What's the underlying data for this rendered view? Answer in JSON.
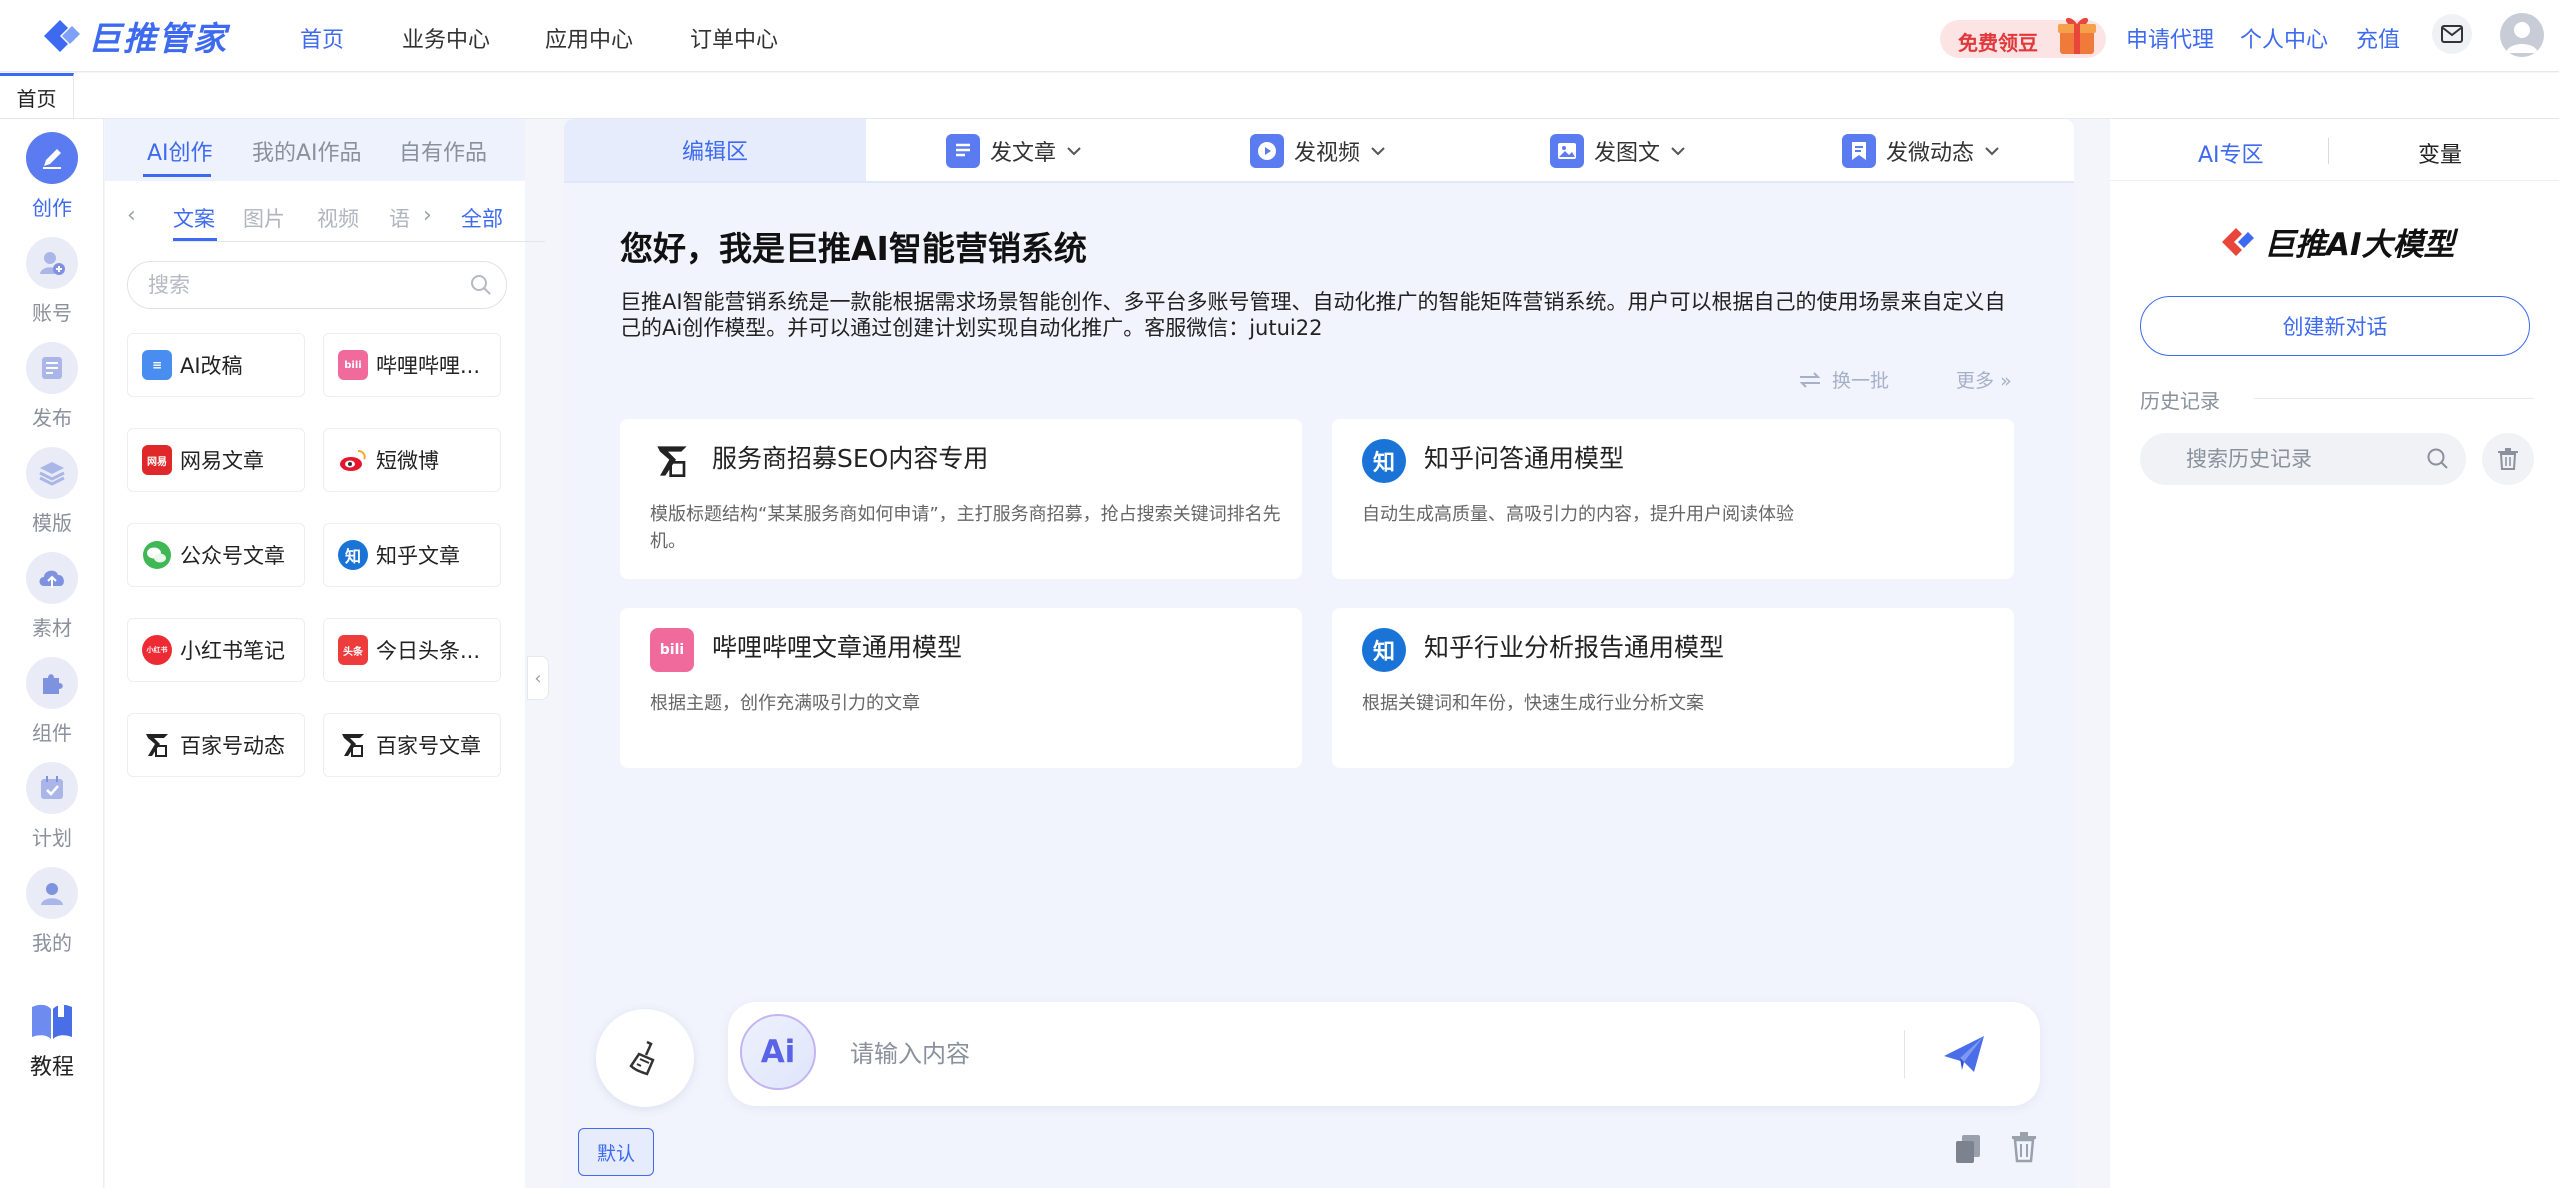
{
  "brand": {
    "name": "巨推管家",
    "accent": "#3d6af0"
  },
  "topnav": {
    "items": [
      "首页",
      "业务中心",
      "应用中心",
      "订单中心"
    ],
    "promo": "免费领豆",
    "right_links": [
      "申请代理",
      "个人中心",
      "充值"
    ]
  },
  "tabs": {
    "home": "首页"
  },
  "rail": {
    "items": [
      {
        "label": "创作",
        "icon": "pen-icon"
      },
      {
        "label": "账号",
        "icon": "user-add-icon"
      },
      {
        "label": "发布",
        "icon": "publish-icon"
      },
      {
        "label": "模版",
        "icon": "layers-icon"
      },
      {
        "label": "素材",
        "icon": "cloud-upload-icon"
      },
      {
        "label": "组件",
        "icon": "puzzle-icon"
      },
      {
        "label": "计划",
        "icon": "calendar-check-icon"
      },
      {
        "label": "我的",
        "icon": "person-icon"
      }
    ],
    "tutorial": "教程"
  },
  "left_panel": {
    "tabs": [
      "AI创作",
      "我的AI作品",
      "自有作品"
    ],
    "subtabs": [
      "文案",
      "图片",
      "视频",
      "语"
    ],
    "all_label": "全部",
    "search_placeholder": "搜索",
    "tools": [
      {
        "name": "AI改稿",
        "color": "#4a8df0",
        "glyph": "≡"
      },
      {
        "name": "哔哩哔哩...",
        "color": "#f06a9b",
        "glyph": "bili"
      },
      {
        "name": "网易文章",
        "color": "#e0282a",
        "glyph": "网易"
      },
      {
        "name": "短微博",
        "color": "#ffffff",
        "glyph": "微"
      },
      {
        "name": "公众号文章",
        "color": "#3fb755",
        "glyph": "●"
      },
      {
        "name": "知乎文章",
        "color": "#1a73d6",
        "glyph": "知"
      },
      {
        "name": "小红书笔记",
        "color": "#ee2b35",
        "glyph": "小红书"
      },
      {
        "name": "今日头条...",
        "color": "#ee3b3b",
        "glyph": "头条"
      },
      {
        "name": "百家号动态",
        "color": "#ffffff",
        "glyph": "百"
      },
      {
        "name": "百家号文章",
        "color": "#ffffff",
        "glyph": "百"
      }
    ]
  },
  "center": {
    "tab_edit": "编辑区",
    "tabs": [
      "发文章",
      "发视频",
      "发图文",
      "发微动态"
    ],
    "greeting_title": "您好，我是巨推AI智能营销系统",
    "greeting_desc": "巨推AI智能营销系统是一款能根据需求场景智能创作、多平台多账号管理、自动化推广的智能矩阵营销系统。用户可以根据自己的使用场景来自定义自己的Ai创作模型。并可以通过创建计划实现自动化推广。客服微信：jutui22",
    "refresh": "换一批",
    "more": "更多",
    "models": [
      {
        "title": "服务商招募SEO内容专用",
        "desc": "模版标题结构“某某服务商如何申请”，主打服务商招募，抢占搜索关键词排名先机。"
      },
      {
        "title": "知乎问答通用模型",
        "desc": "自动生成高质量、高吸引力的内容，提升用户阅读体验"
      },
      {
        "title": "哔哩哔哩文章通用模型",
        "desc": "根据主题，创作充满吸引力的文章"
      },
      {
        "title": "知乎行业分析报告通用模型",
        "desc": "根据关键词和年份，快速生成行业分析文案"
      }
    ],
    "input_placeholder": "请输入内容",
    "ai_badge": "Ai",
    "default_btn": "默认"
  },
  "right_panel": {
    "tabs": [
      "AI专区",
      "变量"
    ],
    "logo_text": "巨推AI大模型",
    "new_chat": "创建新对话",
    "history_label": "历史记录",
    "history_placeholder": "搜索历史记录"
  }
}
